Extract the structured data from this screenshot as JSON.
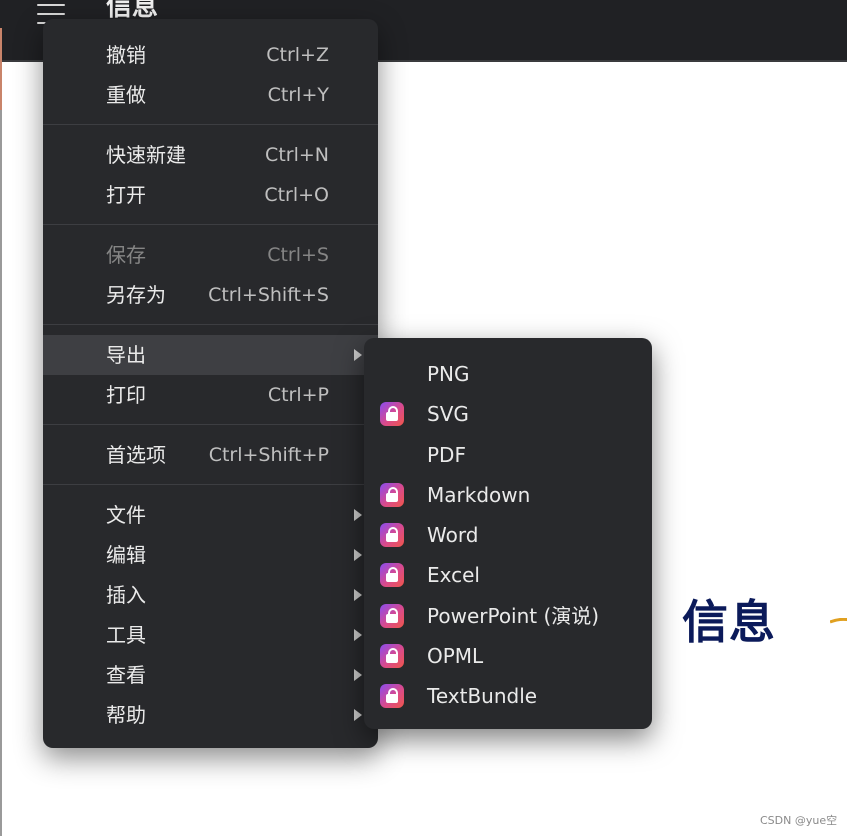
{
  "app": {
    "title": "信息"
  },
  "canvas": {
    "heading": "信息",
    "watermark": "CSDN @yue空"
  },
  "menu": {
    "groups": [
      [
        {
          "label": "撤销",
          "shortcut": "Ctrl+Z"
        },
        {
          "label": "重做",
          "shortcut": "Ctrl+Y"
        }
      ],
      [
        {
          "label": "快速新建",
          "shortcut": "Ctrl+N"
        },
        {
          "label": "打开",
          "shortcut": "Ctrl+O"
        }
      ],
      [
        {
          "label": "保存",
          "shortcut": "Ctrl+S",
          "disabled": true
        },
        {
          "label": "另存为",
          "shortcut": "Ctrl+Shift+S"
        }
      ],
      [
        {
          "label": "导出",
          "submenu": true,
          "active": true
        },
        {
          "label": "打印",
          "shortcut": "Ctrl+P"
        }
      ],
      [
        {
          "label": "首选项",
          "shortcut": "Ctrl+Shift+P"
        }
      ],
      [
        {
          "label": "文件",
          "submenu": true
        },
        {
          "label": "编辑",
          "submenu": true
        },
        {
          "label": "插入",
          "submenu": true
        },
        {
          "label": "工具",
          "submenu": true
        },
        {
          "label": "查看",
          "submenu": true
        },
        {
          "label": "帮助",
          "submenu": true
        }
      ]
    ]
  },
  "export_submenu": {
    "items": [
      {
        "label": "PNG",
        "locked": false
      },
      {
        "label": "SVG",
        "locked": true
      },
      {
        "label": "PDF",
        "locked": false
      },
      {
        "label": "Markdown",
        "locked": true
      },
      {
        "label": "Word",
        "locked": true
      },
      {
        "label": "Excel",
        "locked": true
      },
      {
        "label": "PowerPoint (演说)",
        "locked": true
      },
      {
        "label": "OPML",
        "locked": true
      },
      {
        "label": "TextBundle",
        "locked": true
      }
    ],
    "lock_icon": "lock-icon"
  },
  "colors": {
    "menu_bg": "#28292c",
    "active_bg": "#3e3f43",
    "heading": "#0b1a5a"
  }
}
